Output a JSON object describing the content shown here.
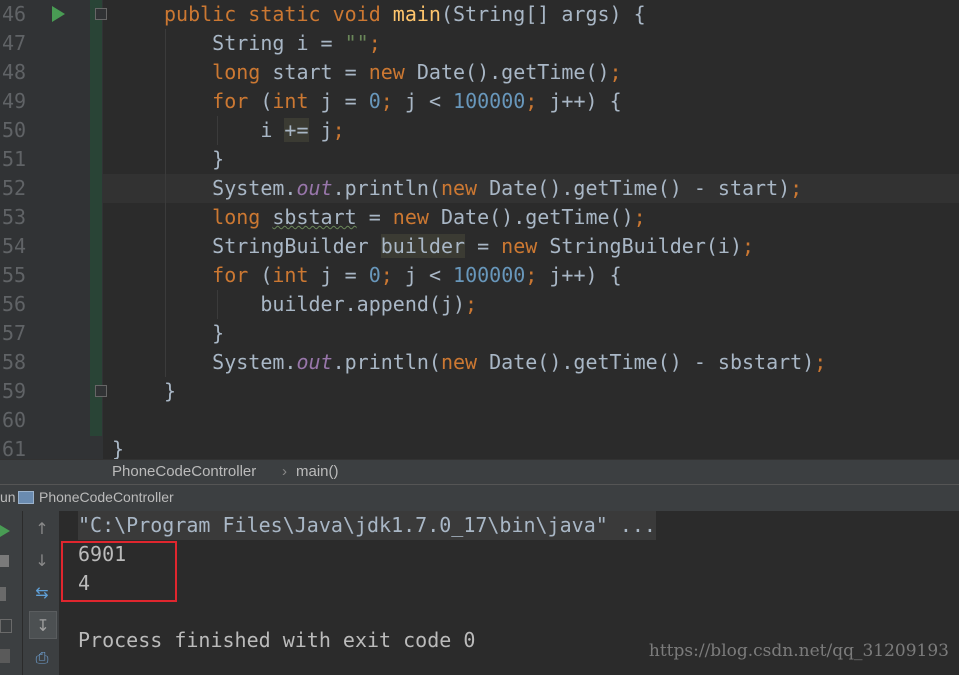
{
  "editor": {
    "line_numbers": [
      "46",
      "47",
      "48",
      "49",
      "50",
      "51",
      "52",
      "53",
      "54",
      "55",
      "56",
      "57",
      "58",
      "59",
      "60",
      "61"
    ],
    "lines": [
      [
        [
          "kw",
          "public static void "
        ],
        [
          "fn",
          "main"
        ],
        [
          "",
          "(String[] args) {"
        ]
      ],
      [
        [
          "",
          "    String i = "
        ],
        [
          "str",
          "\"\""
        ],
        [
          "kw",
          ";"
        ]
      ],
      [
        [
          "kw",
          "    long "
        ],
        [
          "",
          "start = "
        ],
        [
          "kw",
          "new "
        ],
        [
          "",
          "Date().getTime()"
        ],
        [
          "kw",
          ";"
        ]
      ],
      [
        [
          "kw",
          "    for "
        ],
        [
          "",
          "("
        ],
        [
          "kw",
          "int "
        ],
        [
          "",
          "j = "
        ],
        [
          "num",
          "0"
        ],
        [
          "kw",
          "; "
        ],
        [
          "",
          "j < "
        ],
        [
          "num",
          "100000"
        ],
        [
          "kw",
          "; "
        ],
        [
          "",
          "j++) {"
        ]
      ],
      [
        [
          "",
          "        i "
        ],
        [
          "box",
          "+="
        ],
        [
          "kw",
          ""
        ],
        [
          "",
          " j"
        ],
        [
          "kw",
          ";"
        ]
      ],
      [
        [
          "",
          "    }"
        ]
      ],
      [
        [
          "",
          "    System."
        ],
        [
          "fld",
          "out"
        ],
        [
          "",
          ".println("
        ],
        [
          "kw",
          "new "
        ],
        [
          "",
          "Date().getTime() - start)"
        ],
        [
          "kw",
          ";"
        ]
      ],
      [
        [
          "kw",
          "    long "
        ],
        [
          "wavy",
          "sbstart"
        ],
        [
          "",
          " = "
        ],
        [
          "kw",
          "new "
        ],
        [
          "",
          "Date().getTime()"
        ],
        [
          "kw",
          ";"
        ]
      ],
      [
        [
          "",
          "    StringBuilder "
        ],
        [
          "box",
          "builder"
        ],
        [
          "",
          " = "
        ],
        [
          "kw",
          "new "
        ],
        [
          "",
          "StringBuilder(i)"
        ],
        [
          "kw",
          ";"
        ]
      ],
      [
        [
          "kw",
          "    for "
        ],
        [
          "",
          "("
        ],
        [
          "kw",
          "int "
        ],
        [
          "",
          "j = "
        ],
        [
          "num",
          "0"
        ],
        [
          "kw",
          "; "
        ],
        [
          "",
          "j < "
        ],
        [
          "num",
          "100000"
        ],
        [
          "kw",
          "; "
        ],
        [
          "",
          "j++) {"
        ]
      ],
      [
        [
          "",
          "        builder.append(j)"
        ],
        [
          "kw",
          ";"
        ]
      ],
      [
        [
          "",
          "    }"
        ]
      ],
      [
        [
          "",
          "    System."
        ],
        [
          "fld",
          "out"
        ],
        [
          "",
          ".println("
        ],
        [
          "kw",
          "new "
        ],
        [
          "",
          "Date().getTime() - sbstart)"
        ],
        [
          "kw",
          ";"
        ]
      ],
      [
        [
          "",
          "}"
        ]
      ],
      [
        [
          "",
          ""
        ]
      ],
      [
        [
          "",
          "}"
        ]
      ]
    ],
    "colors": {
      "background": "#2b2b2b",
      "keyword": "#cc7832",
      "function": "#ffc66d",
      "number": "#6897bb",
      "string": "#6a8759"
    }
  },
  "breadcrumb": {
    "class_name": "PhoneCodeController",
    "separator": "›",
    "method": "main()"
  },
  "run_panel": {
    "tab_prefix": "un",
    "tab_title": "PhoneCodeController"
  },
  "console": {
    "command": "\"C:\\Program Files\\Java\\jdk1.7.0_17\\bin\\java\" ...",
    "output_1": "6901",
    "output_2": "4",
    "exit_message": "Process finished with exit code 0",
    "highlight_color": "#e0262e"
  },
  "watermark": "https://blog.csdn.net/qq_31209193",
  "icons": [
    "run-icon",
    "fold-icon",
    "up-arrow-icon",
    "down-arrow-icon",
    "soft-wrap-icon",
    "scroll-to-end-icon",
    "print-icon",
    "rerun-icon",
    "stop-icon"
  ]
}
